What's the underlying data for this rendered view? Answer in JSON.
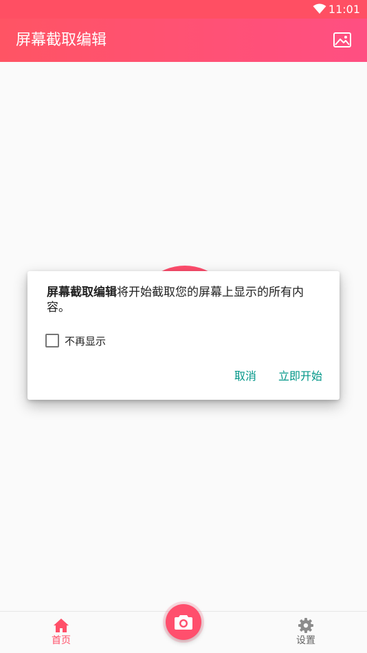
{
  "status_bar": {
    "time": "11:01",
    "wifi_icon": "wifi-icon"
  },
  "app_bar": {
    "title": "屏幕截取编辑",
    "gallery_icon": "image-icon"
  },
  "dialog": {
    "app_name": "屏幕截取编辑",
    "message": "将开始截取您的屏幕上显示的所有内容。",
    "dont_show_label": "不再显示",
    "dont_show_checked": false,
    "cancel_label": "取消",
    "start_label": "立即开始",
    "button_color": "#009688"
  },
  "bottom_nav": {
    "home_label": "首页",
    "settings_label": "设置",
    "home_icon": "home-icon",
    "settings_icon": "gear-icon",
    "capture_icon": "camera-icon"
  },
  "colors": {
    "accent": "#ff4f68",
    "app_bar_start": "#ff5464",
    "app_bar_end": "#ff4f82"
  }
}
